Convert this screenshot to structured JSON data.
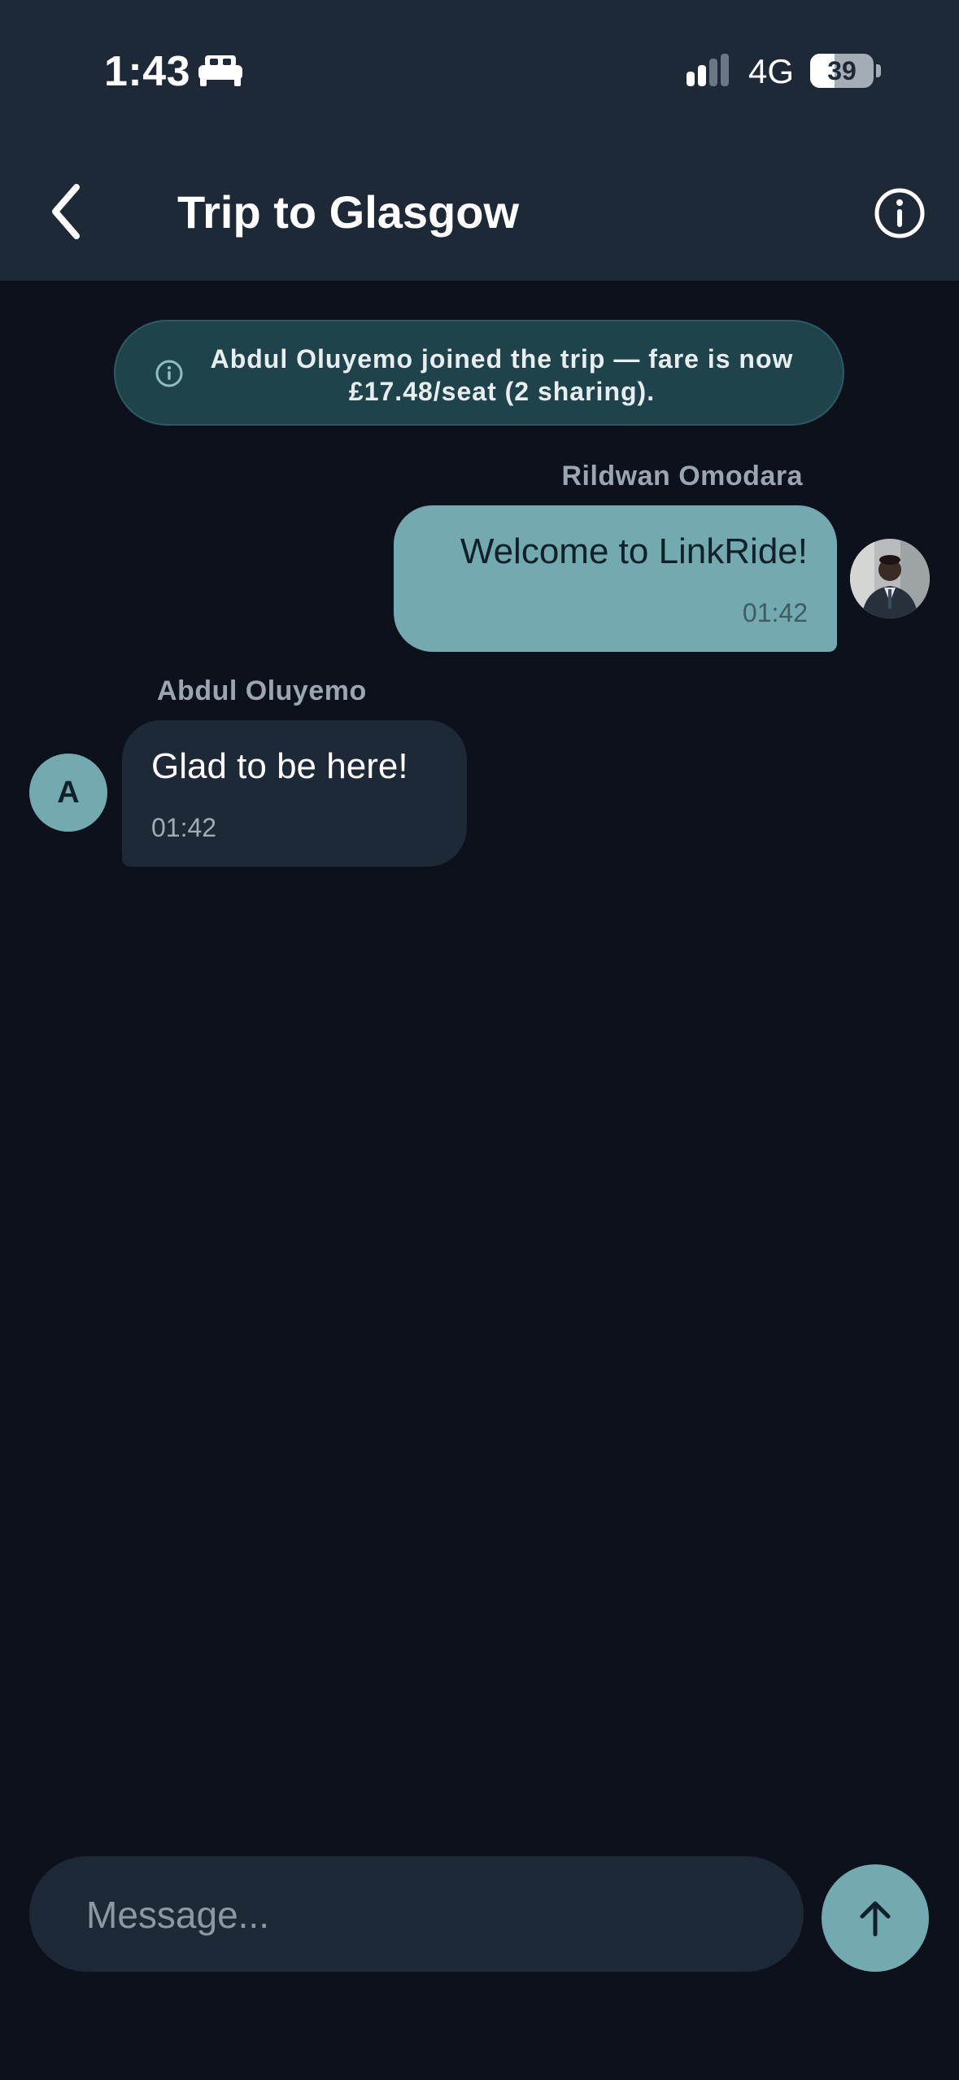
{
  "status_bar": {
    "time": "1:43",
    "focus_icon": "bed-icon",
    "network": "4G",
    "battery": "39",
    "battery_level": 0.39
  },
  "header": {
    "title": "Trip to Glasgow",
    "back_icon": "chevron-left-icon",
    "info_icon": "info-icon",
    "background": "#1e2937"
  },
  "system_notice": {
    "text": "Abdul Oluyemo joined the trip — fare is now £17.48/seat (2 sharing).",
    "icon": "info-icon",
    "background": "#1f434b"
  },
  "messages": [
    {
      "direction": "outgoing",
      "sender": "Rildwan Omodara",
      "text": "Welcome to LinkRide!",
      "time": "01:42",
      "avatar": "photo"
    },
    {
      "direction": "incoming",
      "sender": "Abdul Oluyemo",
      "text": "Glad to be here!",
      "time": "01:42",
      "avatar_initial": "A"
    }
  ],
  "composer": {
    "placeholder": "Message...",
    "value": "",
    "send_icon": "arrow-up-icon"
  },
  "colors": {
    "accent": "#72aab0",
    "background": "#0c111c",
    "surface": "#1e2937"
  }
}
